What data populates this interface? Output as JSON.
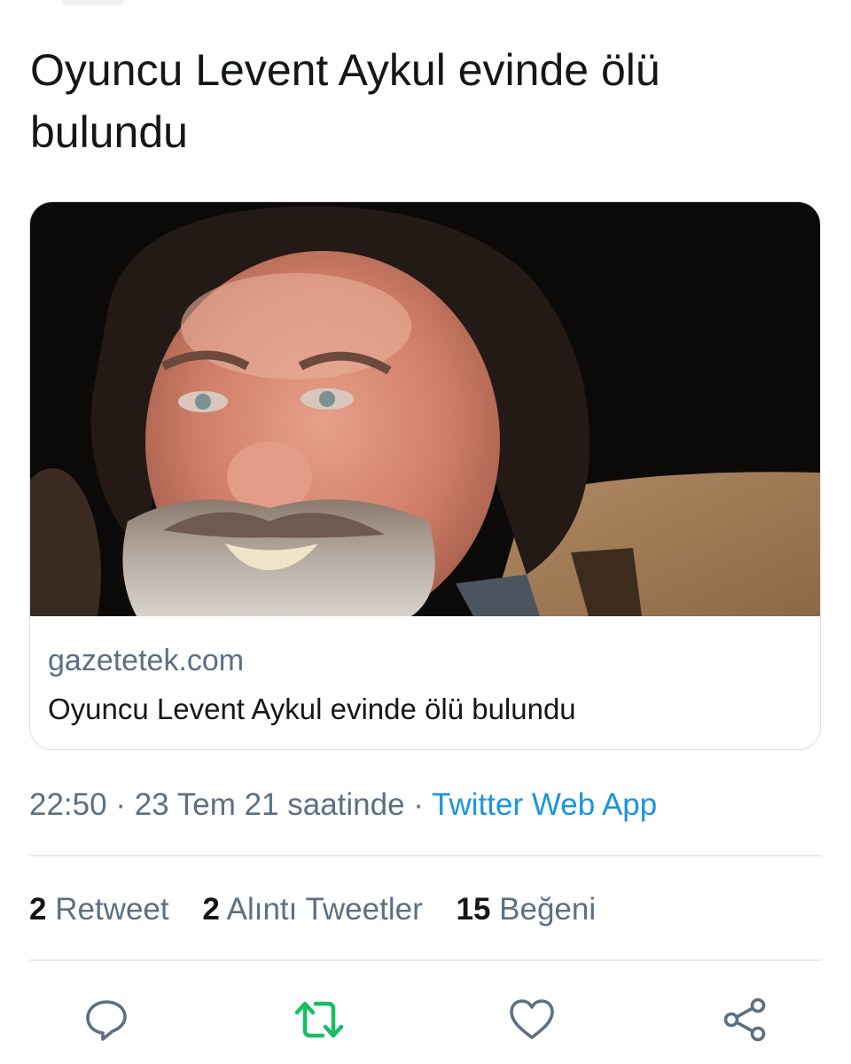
{
  "tweet": {
    "text": "Oyuncu Levent Aykul evinde ölü bulundu"
  },
  "card": {
    "domain": "gazetetek.com",
    "title": "Oyuncu Levent Aykul evinde ölü bulundu"
  },
  "meta": {
    "time": "22:50",
    "separator": " · ",
    "date": "23 Tem 21 saatinde",
    "source": "Twitter Web App"
  },
  "stats": [
    {
      "count": "2",
      "label": "Retweet"
    },
    {
      "count": "2",
      "label": "Alıntı Tweetler"
    },
    {
      "count": "15",
      "label": "Beğeni"
    }
  ],
  "actions": {
    "reply_icon": "reply-icon",
    "retweet_icon": "retweet-icon",
    "like_icon": "heart-icon",
    "share_icon": "share-icon"
  },
  "colors": {
    "text_primary": "#14171a",
    "text_secondary": "#5b7083",
    "link_blue": "#1b95e0",
    "retweet_green": "#17bf63",
    "divider": "#e6ecf0"
  }
}
